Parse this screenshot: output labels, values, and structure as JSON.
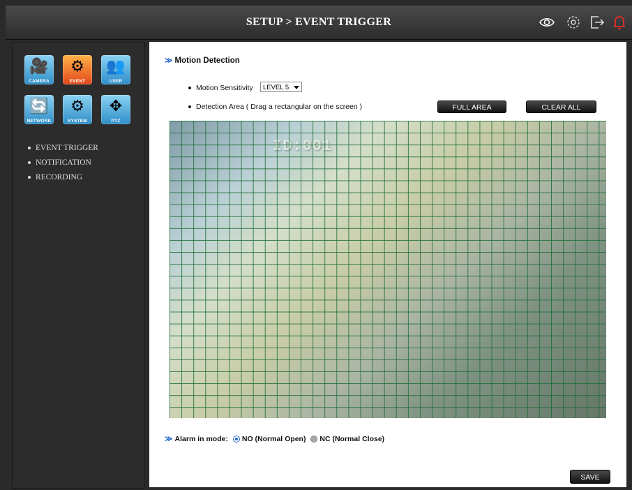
{
  "header": {
    "title": "SETUP > EVENT TRIGGER",
    "icons": [
      "eye-icon",
      "settings-icon",
      "logout-icon",
      "alarm-bell-icon"
    ],
    "alarm_color": "#e8302a"
  },
  "sidebar": {
    "tiles": [
      {
        "label": "CAMERA",
        "icon": "camera-icon"
      },
      {
        "label": "EVENT",
        "icon": "event-icon",
        "active": true
      },
      {
        "label": "USER",
        "icon": "user-icon"
      },
      {
        "label": "NETWORK",
        "icon": "network-icon"
      },
      {
        "label": "SYSTEM",
        "icon": "system-icon"
      },
      {
        "label": "PTZ",
        "icon": "ptz-icon"
      }
    ],
    "items": [
      {
        "label": "EVENT TRIGGER"
      },
      {
        "label": "NOTIFICATION"
      },
      {
        "label": "RECORDING"
      }
    ]
  },
  "main": {
    "section_title": "Motion Detection",
    "sensitivity_label": "Motion Sensitivity",
    "sensitivity_value": "LEVEL 5",
    "area_label": "Detection Area ( Drag a rectangular on the screen )",
    "full_area_button": "FULL AREA",
    "clear_all_button": "CLEAR ALL",
    "camera_id": "ID:001",
    "alarm_label": "Alarm in mode:",
    "alarm_no": "NO (Normal Open)",
    "alarm_nc": "NC (Normal Close)",
    "alarm_selected": "NO",
    "save_button": "SAVE"
  }
}
